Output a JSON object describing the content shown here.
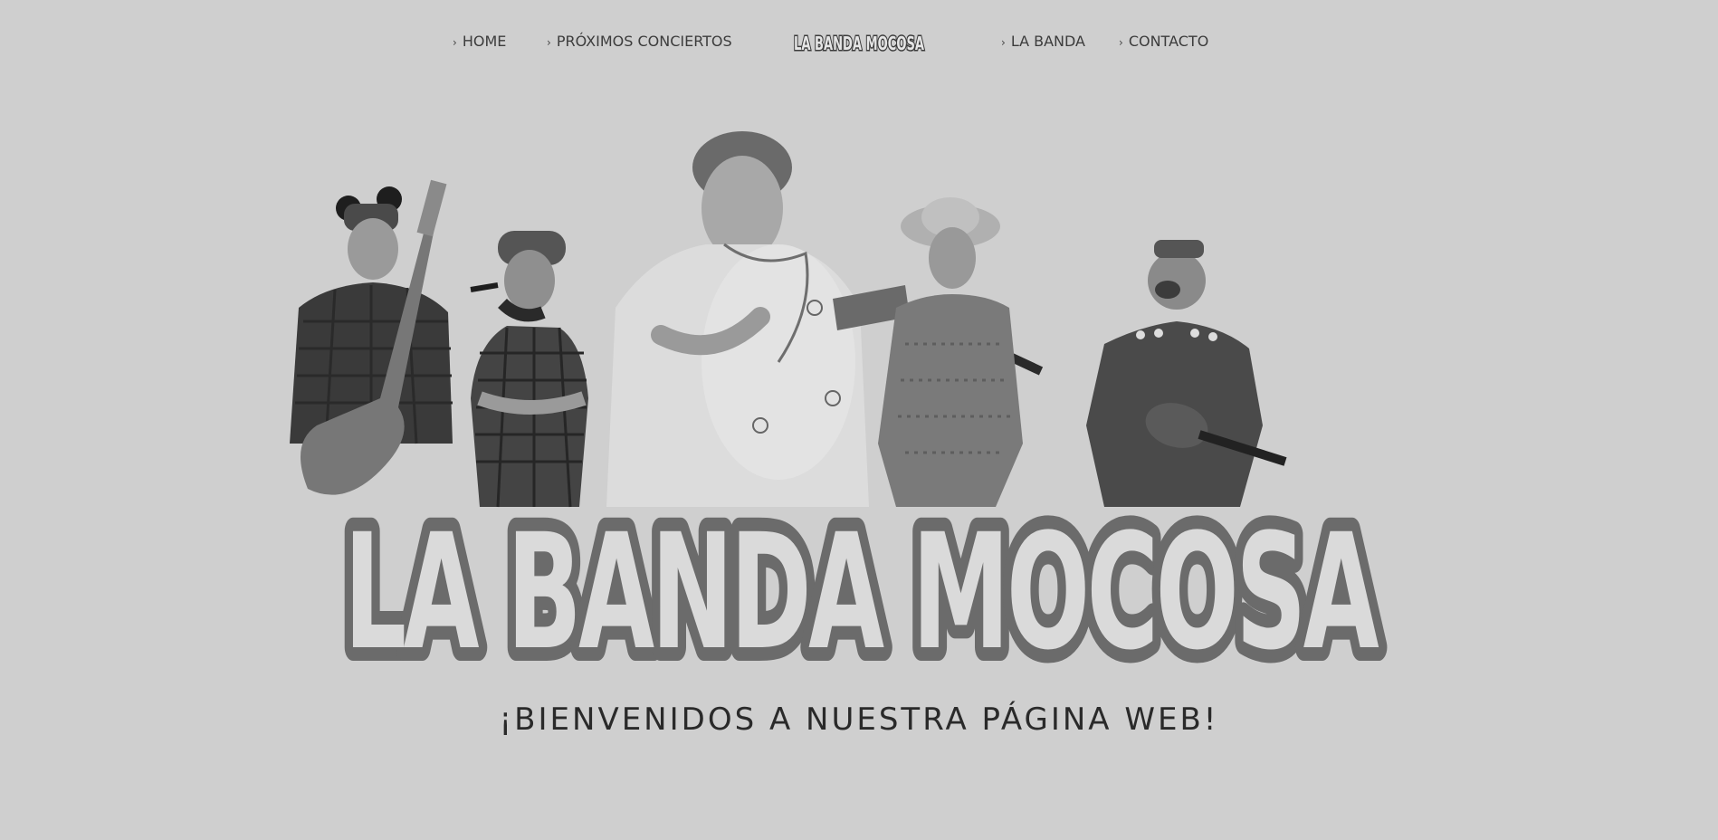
{
  "nav": {
    "items": [
      {
        "label": "HOME"
      },
      {
        "label": "PRÓXIMOS CONCIERTOS"
      },
      {
        "label": "LA BANDA"
      },
      {
        "label": "CONTACTO"
      }
    ],
    "logo_text": "LA BANDA MOCOSA"
  },
  "hero": {
    "logo_text": "LA BANDA MOCOSA"
  },
  "welcome": {
    "text": "¡BIENVENIDOS A NUESTRA PÁGINA WEB!"
  },
  "colors": {
    "background": "#cfcfcf",
    "text": "#2a2a2a"
  }
}
